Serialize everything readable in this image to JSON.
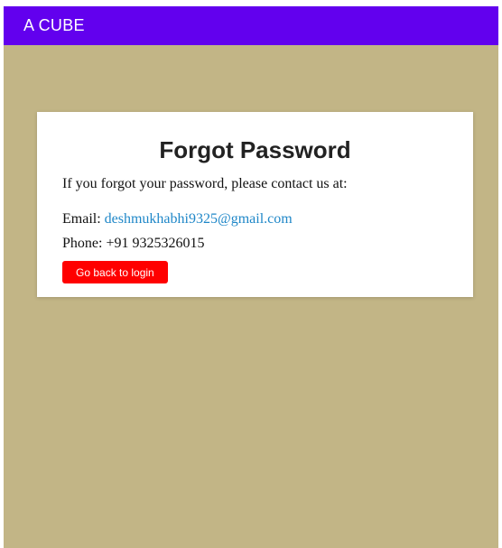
{
  "app_bar": {
    "title": "A CUBE"
  },
  "card": {
    "title": "Forgot Password",
    "message": "If you forgot your password, please contact us at:",
    "email_label": "Email:",
    "email": "deshmukhabhi9325@gmail.com",
    "phone_label": "Phone:",
    "phone": "+91 9325326015",
    "back_button": "Go back to login"
  },
  "colors": {
    "app_bar": "#6200ee",
    "background": "#c2b586",
    "link": "#1f87c8",
    "button": "#ff0000"
  }
}
